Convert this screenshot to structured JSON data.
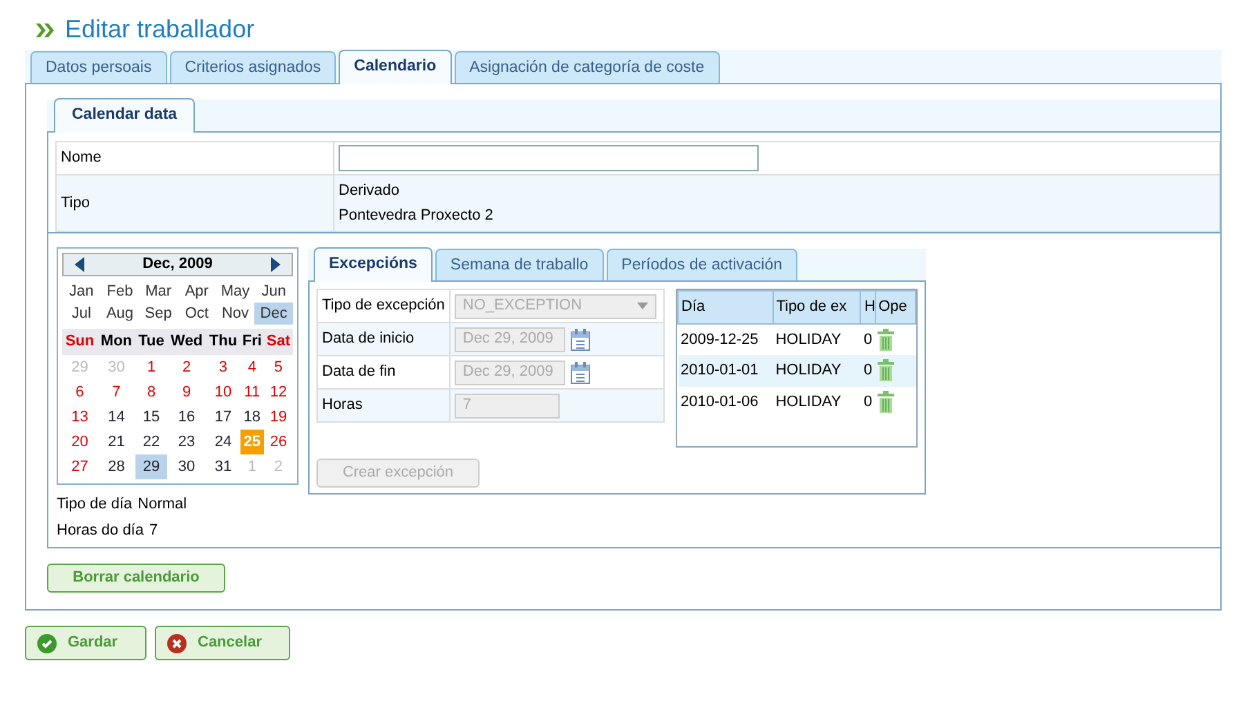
{
  "page_title": "Editar traballador",
  "tabs": [
    {
      "label": "Datos persoais",
      "selected": false
    },
    {
      "label": "Criterios asignados",
      "selected": false
    },
    {
      "label": "Calendario",
      "selected": true
    },
    {
      "label": "Asignación de categoría de coste",
      "selected": false
    }
  ],
  "inner_tabs": [
    {
      "label": "Calendar data",
      "selected": true
    }
  ],
  "form": {
    "rows": [
      {
        "label": "Nome",
        "kind": "input",
        "value": ""
      },
      {
        "label": "Tipo",
        "kind": "text",
        "lines": [
          "Derivado",
          "Pontevedra Proxecto 2"
        ]
      }
    ]
  },
  "calendar": {
    "title": "Dec, 2009",
    "months": [
      {
        "label": "Jan",
        "selected": false
      },
      {
        "label": "Feb",
        "selected": false
      },
      {
        "label": "Mar",
        "selected": false
      },
      {
        "label": "Apr",
        "selected": false
      },
      {
        "label": "May",
        "selected": false
      },
      {
        "label": "Jun",
        "selected": false
      },
      {
        "label": "Jul",
        "selected": false
      },
      {
        "label": "Aug",
        "selected": false
      },
      {
        "label": "Sep",
        "selected": false
      },
      {
        "label": "Oct",
        "selected": false
      },
      {
        "label": "Nov",
        "selected": false
      },
      {
        "label": "Dec",
        "selected": true
      }
    ],
    "weekdays": [
      {
        "label": "Sun",
        "kind": "weekend"
      },
      {
        "label": "Mon",
        "kind": "weekday"
      },
      {
        "label": "Tue",
        "kind": "weekday"
      },
      {
        "label": "Wed",
        "kind": "weekday"
      },
      {
        "label": "Thu",
        "kind": "weekday"
      },
      {
        "label": "Fri",
        "kind": "weekday"
      },
      {
        "label": "Sat",
        "kind": "weekend"
      }
    ],
    "days": [
      {
        "label": "29",
        "kind": "other",
        "selected": false
      },
      {
        "label": "30",
        "kind": "other",
        "selected": false
      },
      {
        "label": "1",
        "kind": "holiday",
        "selected": false
      },
      {
        "label": "2",
        "kind": "holiday",
        "selected": false
      },
      {
        "label": "3",
        "kind": "holiday",
        "selected": false
      },
      {
        "label": "4",
        "kind": "holiday",
        "selected": false
      },
      {
        "label": "5",
        "kind": "holiday",
        "selected": false
      },
      {
        "label": "6",
        "kind": "holiday",
        "selected": false
      },
      {
        "label": "7",
        "kind": "holiday",
        "selected": false
      },
      {
        "label": "8",
        "kind": "holiday",
        "selected": false
      },
      {
        "label": "9",
        "kind": "holiday",
        "selected": false
      },
      {
        "label": "10",
        "kind": "holiday",
        "selected": false
      },
      {
        "label": "11",
        "kind": "holiday",
        "selected": false
      },
      {
        "label": "12",
        "kind": "holiday",
        "selected": false
      },
      {
        "label": "13",
        "kind": "holiday",
        "selected": false
      },
      {
        "label": "14",
        "kind": "work",
        "selected": false
      },
      {
        "label": "15",
        "kind": "work",
        "selected": false
      },
      {
        "label": "16",
        "kind": "work",
        "selected": false
      },
      {
        "label": "17",
        "kind": "work",
        "selected": false
      },
      {
        "label": "18",
        "kind": "work",
        "selected": false
      },
      {
        "label": "19",
        "kind": "holiday",
        "selected": false
      },
      {
        "label": "20",
        "kind": "holiday",
        "selected": false
      },
      {
        "label": "21",
        "kind": "work",
        "selected": false
      },
      {
        "label": "22",
        "kind": "work",
        "selected": false
      },
      {
        "label": "23",
        "kind": "work",
        "selected": false
      },
      {
        "label": "24",
        "kind": "work",
        "selected": false
      },
      {
        "label": "25",
        "kind": "today",
        "selected": false
      },
      {
        "label": "26",
        "kind": "holiday",
        "selected": false
      },
      {
        "label": "27",
        "kind": "holiday",
        "selected": false
      },
      {
        "label": "28",
        "kind": "work",
        "selected": false
      },
      {
        "label": "29",
        "kind": "work",
        "selected": true
      },
      {
        "label": "30",
        "kind": "work",
        "selected": false
      },
      {
        "label": "31",
        "kind": "work",
        "selected": false
      },
      {
        "label": "1",
        "kind": "other",
        "selected": false
      },
      {
        "label": "2",
        "kind": "other",
        "selected": false
      }
    ]
  },
  "day_info": [
    {
      "label": "Tipo de día",
      "value": "Normal"
    },
    {
      "label": "Horas do día",
      "value": "7"
    }
  ],
  "exception_tabs": [
    {
      "label": "Excepcións",
      "selected": true
    },
    {
      "label": "Semana de traballo",
      "selected": false
    },
    {
      "label": "Períodos de activación",
      "selected": false
    }
  ],
  "exception_form": [
    {
      "label": "Tipo de excepción",
      "kind": "select",
      "value": "NO_EXCEPTION",
      "disabled": true
    },
    {
      "label": "Data de inicio",
      "kind": "date",
      "value": "Dec 29, 2009",
      "disabled": true
    },
    {
      "label": "Data de fin",
      "kind": "date",
      "value": "Dec 29, 2009",
      "disabled": true
    },
    {
      "label": "Horas",
      "kind": "number",
      "value": "7",
      "disabled": true
    }
  ],
  "create_button": {
    "label": "Crear excepción",
    "disabled": true
  },
  "exceptions_table": {
    "columns": [
      "Día",
      "Tipo de ex",
      "H",
      "Ope"
    ],
    "rows": [
      [
        "2009-12-25",
        "HOLIDAY",
        "0"
      ],
      [
        "2010-01-01",
        "HOLIDAY",
        "0"
      ],
      [
        "2010-01-06",
        "HOLIDAY",
        "0"
      ]
    ]
  },
  "delete_calendar_button": "Borrar calendario",
  "actions": [
    {
      "label": "Gardar",
      "kind": "save"
    },
    {
      "label": "Cancelar",
      "kind": "cancel"
    }
  ]
}
